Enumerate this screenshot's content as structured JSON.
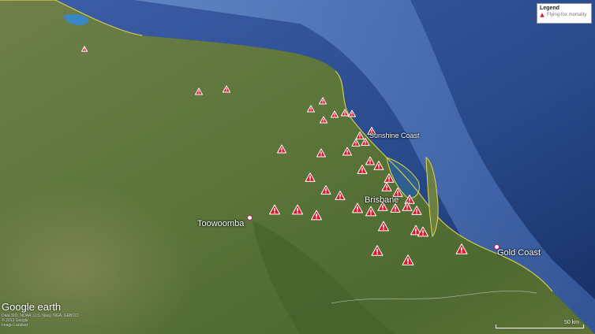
{
  "map": {
    "places": [
      {
        "id": "toowoomba",
        "name": "Toowoomba"
      },
      {
        "id": "brisbane",
        "name": "Brisbane"
      },
      {
        "id": "sunshine-coast",
        "name": "Sunshine Coast"
      },
      {
        "id": "gold-coast",
        "name": "Gold Coast"
      }
    ],
    "marker_icon": "warning-triangle-icon",
    "marker_color": "#d81b2c",
    "coast_highlight_color": "#e3d64a",
    "ocean_color": "#2a4f8f",
    "land_color": "#5f7a3e"
  },
  "legend": {
    "title": "Legend",
    "items": [
      {
        "label": "Flying-fox mortality",
        "icon": "warning-triangle-icon"
      }
    ]
  },
  "attribution": {
    "logo": "Google earth",
    "credits": [
      "Data SIO, NOAA, U.S. Navy, NGA, GEBCO",
      "© 2013 Google",
      "Image Landsat"
    ]
  },
  "scale": {
    "label": "50 km"
  }
}
